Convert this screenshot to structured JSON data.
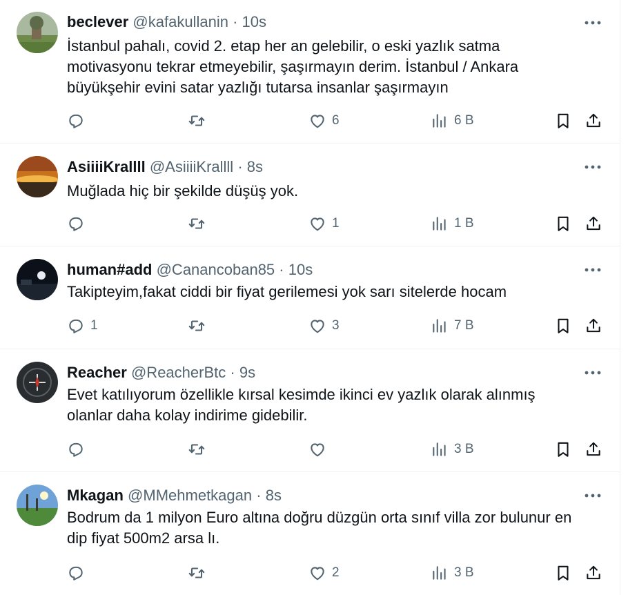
{
  "tweets": [
    {
      "name": "beclever",
      "handle": "@kafakullanin",
      "sep": "·",
      "time": "10s",
      "text_lines": [
        "İstanbul pahalı, covid 2. etap her an gelebilir, o eski yazlık satma",
        "motivasyonu tekrar etmeyebilir, şaşırmayın derim. İstanbul / Ankara",
        "büyükşehir evini satar yazlığı tutarsa insanlar şaşırmayın"
      ],
      "replies": "",
      "retweets": "",
      "likes": "6",
      "views": "6 B",
      "avatar": "grass-field-tree"
    },
    {
      "name": "AsiiiiKrallll",
      "handle": "@AsiiiiKrallll",
      "sep": "·",
      "time": "8s",
      "text_lines": [
        "Muğlada hiç bir şekilde düşüş yok."
      ],
      "replies": "",
      "retweets": "",
      "likes": "1",
      "views": "1 B",
      "avatar": "sunset-sea"
    },
    {
      "name": "human#add",
      "handle": "@Canancoban85",
      "sep": "·",
      "time": "10s",
      "text_lines": [
        "Takipteyim,fakat ciddi bir fiyat gerilemesi yok sarı sitelerde hocam"
      ],
      "replies": "1",
      "retweets": "",
      "likes": "3",
      "views": "7 B",
      "avatar": "night-moon"
    },
    {
      "name": "Reacher",
      "handle": "@ReacherBtc",
      "sep": "·",
      "time": "9s",
      "text_lines": [
        "Evet katılıyorum özellikle kırsal kesimde ikinci ev yazlık olarak alınmış",
        "olanlar daha kolay indirime gidebilir."
      ],
      "replies": "",
      "retweets": "",
      "likes": "",
      "views": "3 B",
      "avatar": "compass-dark"
    },
    {
      "name": "Mkagan",
      "handle": "@MMehmetkagan",
      "sep": "·",
      "time": "8s",
      "text_lines": [
        "Bodrum da 1 milyon Euro altına doğru düzgün orta sınıf villa zor bulunur en",
        "dip fiyat 500m2 arsa lı."
      ],
      "replies": "",
      "retweets": "",
      "likes": "2",
      "views": "3 B",
      "avatar": "sunny-meadow"
    }
  ],
  "colors": {
    "text": "#0f1419",
    "secondary": "#536471",
    "border": "#eff3f4"
  },
  "icons": [
    "more-icon",
    "reply-icon",
    "retweet-icon",
    "like-icon",
    "views-icon",
    "bookmark-icon",
    "share-icon"
  ]
}
